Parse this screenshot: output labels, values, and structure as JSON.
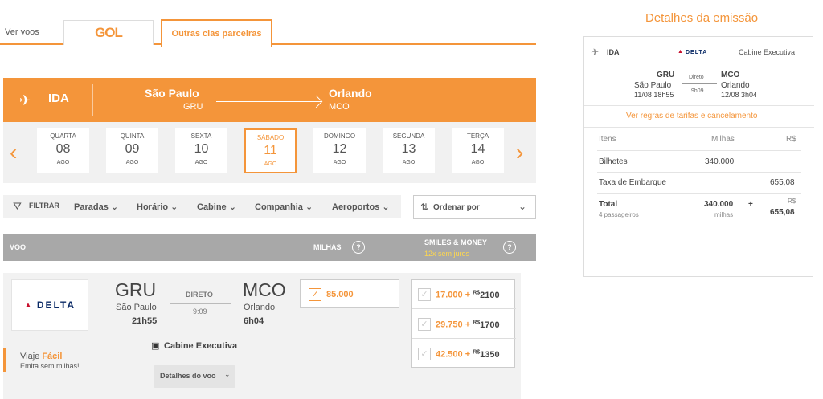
{
  "tabs": {
    "ver_voos": "Ver voos",
    "gol_logo": "GOL",
    "outras": "Outras cias parceiras"
  },
  "ida": {
    "label": "IDA",
    "origin_city": "São Paulo",
    "origin_code": "GRU",
    "dest_city": "Orlando",
    "dest_code": "MCO"
  },
  "dates": [
    {
      "dow": "QUARTA",
      "day": "08",
      "month": "AGO"
    },
    {
      "dow": "QUINTA",
      "day": "09",
      "month": "AGO"
    },
    {
      "dow": "SEXTA",
      "day": "10",
      "month": "AGO"
    },
    {
      "dow": "SÁBADO",
      "day": "11",
      "month": "AGO"
    },
    {
      "dow": "DOMINGO",
      "day": "12",
      "month": "AGO"
    },
    {
      "dow": "SEGUNDA",
      "day": "13",
      "month": "AGO"
    },
    {
      "dow": "TERÇA",
      "day": "14",
      "month": "AGO"
    }
  ],
  "filters": {
    "filtrar": "FILTRAR",
    "paradas": "Paradas",
    "horario": "Horário",
    "cabine": "Cabine",
    "companhia": "Companhia",
    "aeroportos": "Aeroportos",
    "ordenar": "Ordenar por"
  },
  "table_header": {
    "voo": "VOO",
    "milhas": "MILHAS",
    "smiles_money": "SMILES & MONEY",
    "juros": "12x sem juros",
    "help": "?"
  },
  "flight": {
    "airline": "DELTA",
    "origin_code": "GRU",
    "origin_city": "São Paulo",
    "origin_time": "21h55",
    "stops": "DIRETO",
    "duration": "9:09",
    "dest_code": "MCO",
    "dest_city": "Orlando",
    "dest_time": "6h04",
    "cabin": "Cabine Executiva",
    "details": "Detalhes do voo",
    "viaje": "Viaje",
    "facil": "Fácil",
    "emita": "Emita sem milhas!",
    "miles": "85.000",
    "money_options": [
      {
        "miles": "17.000",
        "plus": "+",
        "currency": "R$",
        "amount": "2100"
      },
      {
        "miles": "29.750",
        "plus": "+",
        "currency": "R$",
        "amount": "1700"
      },
      {
        "miles": "42.500",
        "plus": "+",
        "currency": "R$",
        "amount": "1350"
      }
    ]
  },
  "summary": {
    "title": "Detalhes da emissão",
    "ida": "IDA",
    "airline": "DELTA",
    "cabin": "Cabine Executiva",
    "origin_code": "GRU",
    "origin_city": "São Paulo",
    "origin_dt": "11/08 18h55",
    "stops": "Direto",
    "duration": "9h09",
    "dest_code": "MCO",
    "dest_city": "Orlando",
    "dest_dt": "12/08 3h04",
    "rules_link": "Ver regras de tarifas e cancelamento",
    "col_itens": "Itens",
    "col_milhas": "Milhas",
    "col_rs": "R$",
    "bilhetes": "Bilhetes",
    "bilhetes_milhas": "340.000",
    "taxa": "Taxa de Embarque",
    "taxa_rs": "655,08",
    "total": "Total",
    "passageiros": "4 passageiros",
    "total_milhas": "340.000",
    "milhas_unit": "milhas",
    "plus": "+",
    "total_rs_label": "R$",
    "total_rs": "655,08"
  },
  "colors": {
    "accent": "#f4953a",
    "header_gray": "#a8a8a8"
  }
}
